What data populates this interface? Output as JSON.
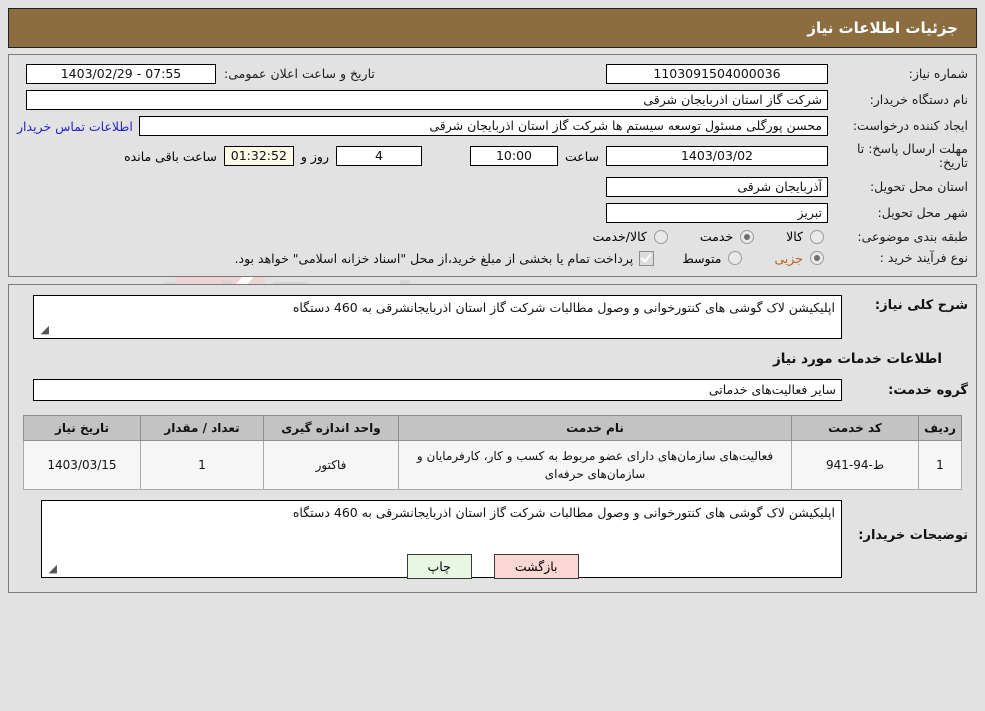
{
  "window": {
    "title": "جزئیات اطلاعات نیاز"
  },
  "colors": {
    "header_bg": "#8c6d40",
    "page_bg": "#e2e2e2",
    "link": "#2323c8",
    "highlight_text": "#b5651d",
    "table_header_bg": "#c3c3c3",
    "table_row_bg": "#f6f6f6",
    "countdown_bg": "#fbfbe8",
    "back_button_bg": "#fbd7d3",
    "print_button_bg": "#e8f7e2"
  },
  "watermark": {
    "text": "AriaTender",
    "suffix": ".net"
  },
  "top_info": {
    "need_number_label": "شماره نیاز:",
    "need_number_value": "1103091504000036",
    "announce_datetime_label": "تاریخ و ساعت اعلان عمومی:",
    "announce_datetime_value": "07:55 - 1403/02/29",
    "buyer_org_label": "نام دستگاه خریدار:",
    "buyer_org_value": "شرکت گاز استان اذربایجان شرقی",
    "creator_label": "ایجاد کننده درخواست:",
    "creator_value": "محسن پورگلی  مسئول توسعه سیستم ها  شرکت گاز استان اذربایجان شرقی",
    "contact_link": "اطلاعات تماس خریدار",
    "deadline_label": "مهلت ارسال پاسخ: تا تاریخ:",
    "deadline_date": "1403/03/02",
    "deadline_hour_label": "ساعت",
    "deadline_hour": "10:00",
    "days_value": "4",
    "days_label": "روز و",
    "countdown_value": "01:32:52",
    "countdown_label": "ساعت باقی مانده",
    "province_label": "استان محل تحویل:",
    "province_value": "آذربایجان شرقی",
    "city_label": "شهر محل تحویل:",
    "city_value": "تبریز",
    "category_label": "طبقه بندی موضوعی:",
    "category_options": [
      {
        "label": "کالا",
        "selected": false
      },
      {
        "label": "خدمت",
        "selected": true
      },
      {
        "label": "کالا/خدمت",
        "selected": false
      }
    ],
    "process_label": "نوع فرآیند خرید :",
    "process_options": [
      {
        "label": "جزیی",
        "selected": true,
        "highlight": true
      },
      {
        "label": "متوسط",
        "selected": false,
        "highlight": false
      }
    ],
    "treasury_checkbox_checked": true,
    "treasury_note": "پرداخت تمام یا بخشی از مبلغ خرید،از محل \"اسناد خزانه اسلامی\" خواهد بود."
  },
  "body": {
    "general_desc_label": "شرح کلی نیاز:",
    "general_desc_value": "اپلیکیشن لاک گوشی های کنتورخوانی و وصول مطالبات شرکت گاز استان اذربایجانشرقی به 460 دستگاه",
    "services_section_title": "اطلاعات خدمات مورد نیاز",
    "service_group_label": "گروه خدمت:",
    "service_group_value": "سایر فعالیت‌های خدماتی",
    "table": {
      "headers": [
        "ردیف",
        "کد خدمت",
        "نام خدمت",
        "واحد اندازه گیری",
        "تعداد / مقدار",
        "تاریخ نیاز"
      ],
      "rows": [
        {
          "row_no": "1",
          "service_code": "ط-94-941",
          "service_name": "فعالیت‌های سازمان‌های دارای عضو مربوط به کسب و کار، کارفرمایان و سازمان‌های حرفه‌ای",
          "unit": "فاکتور",
          "quantity": "1",
          "need_date": "1403/03/15"
        }
      ]
    },
    "buyer_notes_label": "توضیحات خریدار:",
    "buyer_notes_value": "اپلیکیشن لاک گوشی های کنتورخوانی و وصول مطالبات شرکت گاز استان اذربایجانشرقی به 460 دستگاه"
  },
  "footer": {
    "back_label": "بازگشت",
    "print_label": "چاپ"
  }
}
